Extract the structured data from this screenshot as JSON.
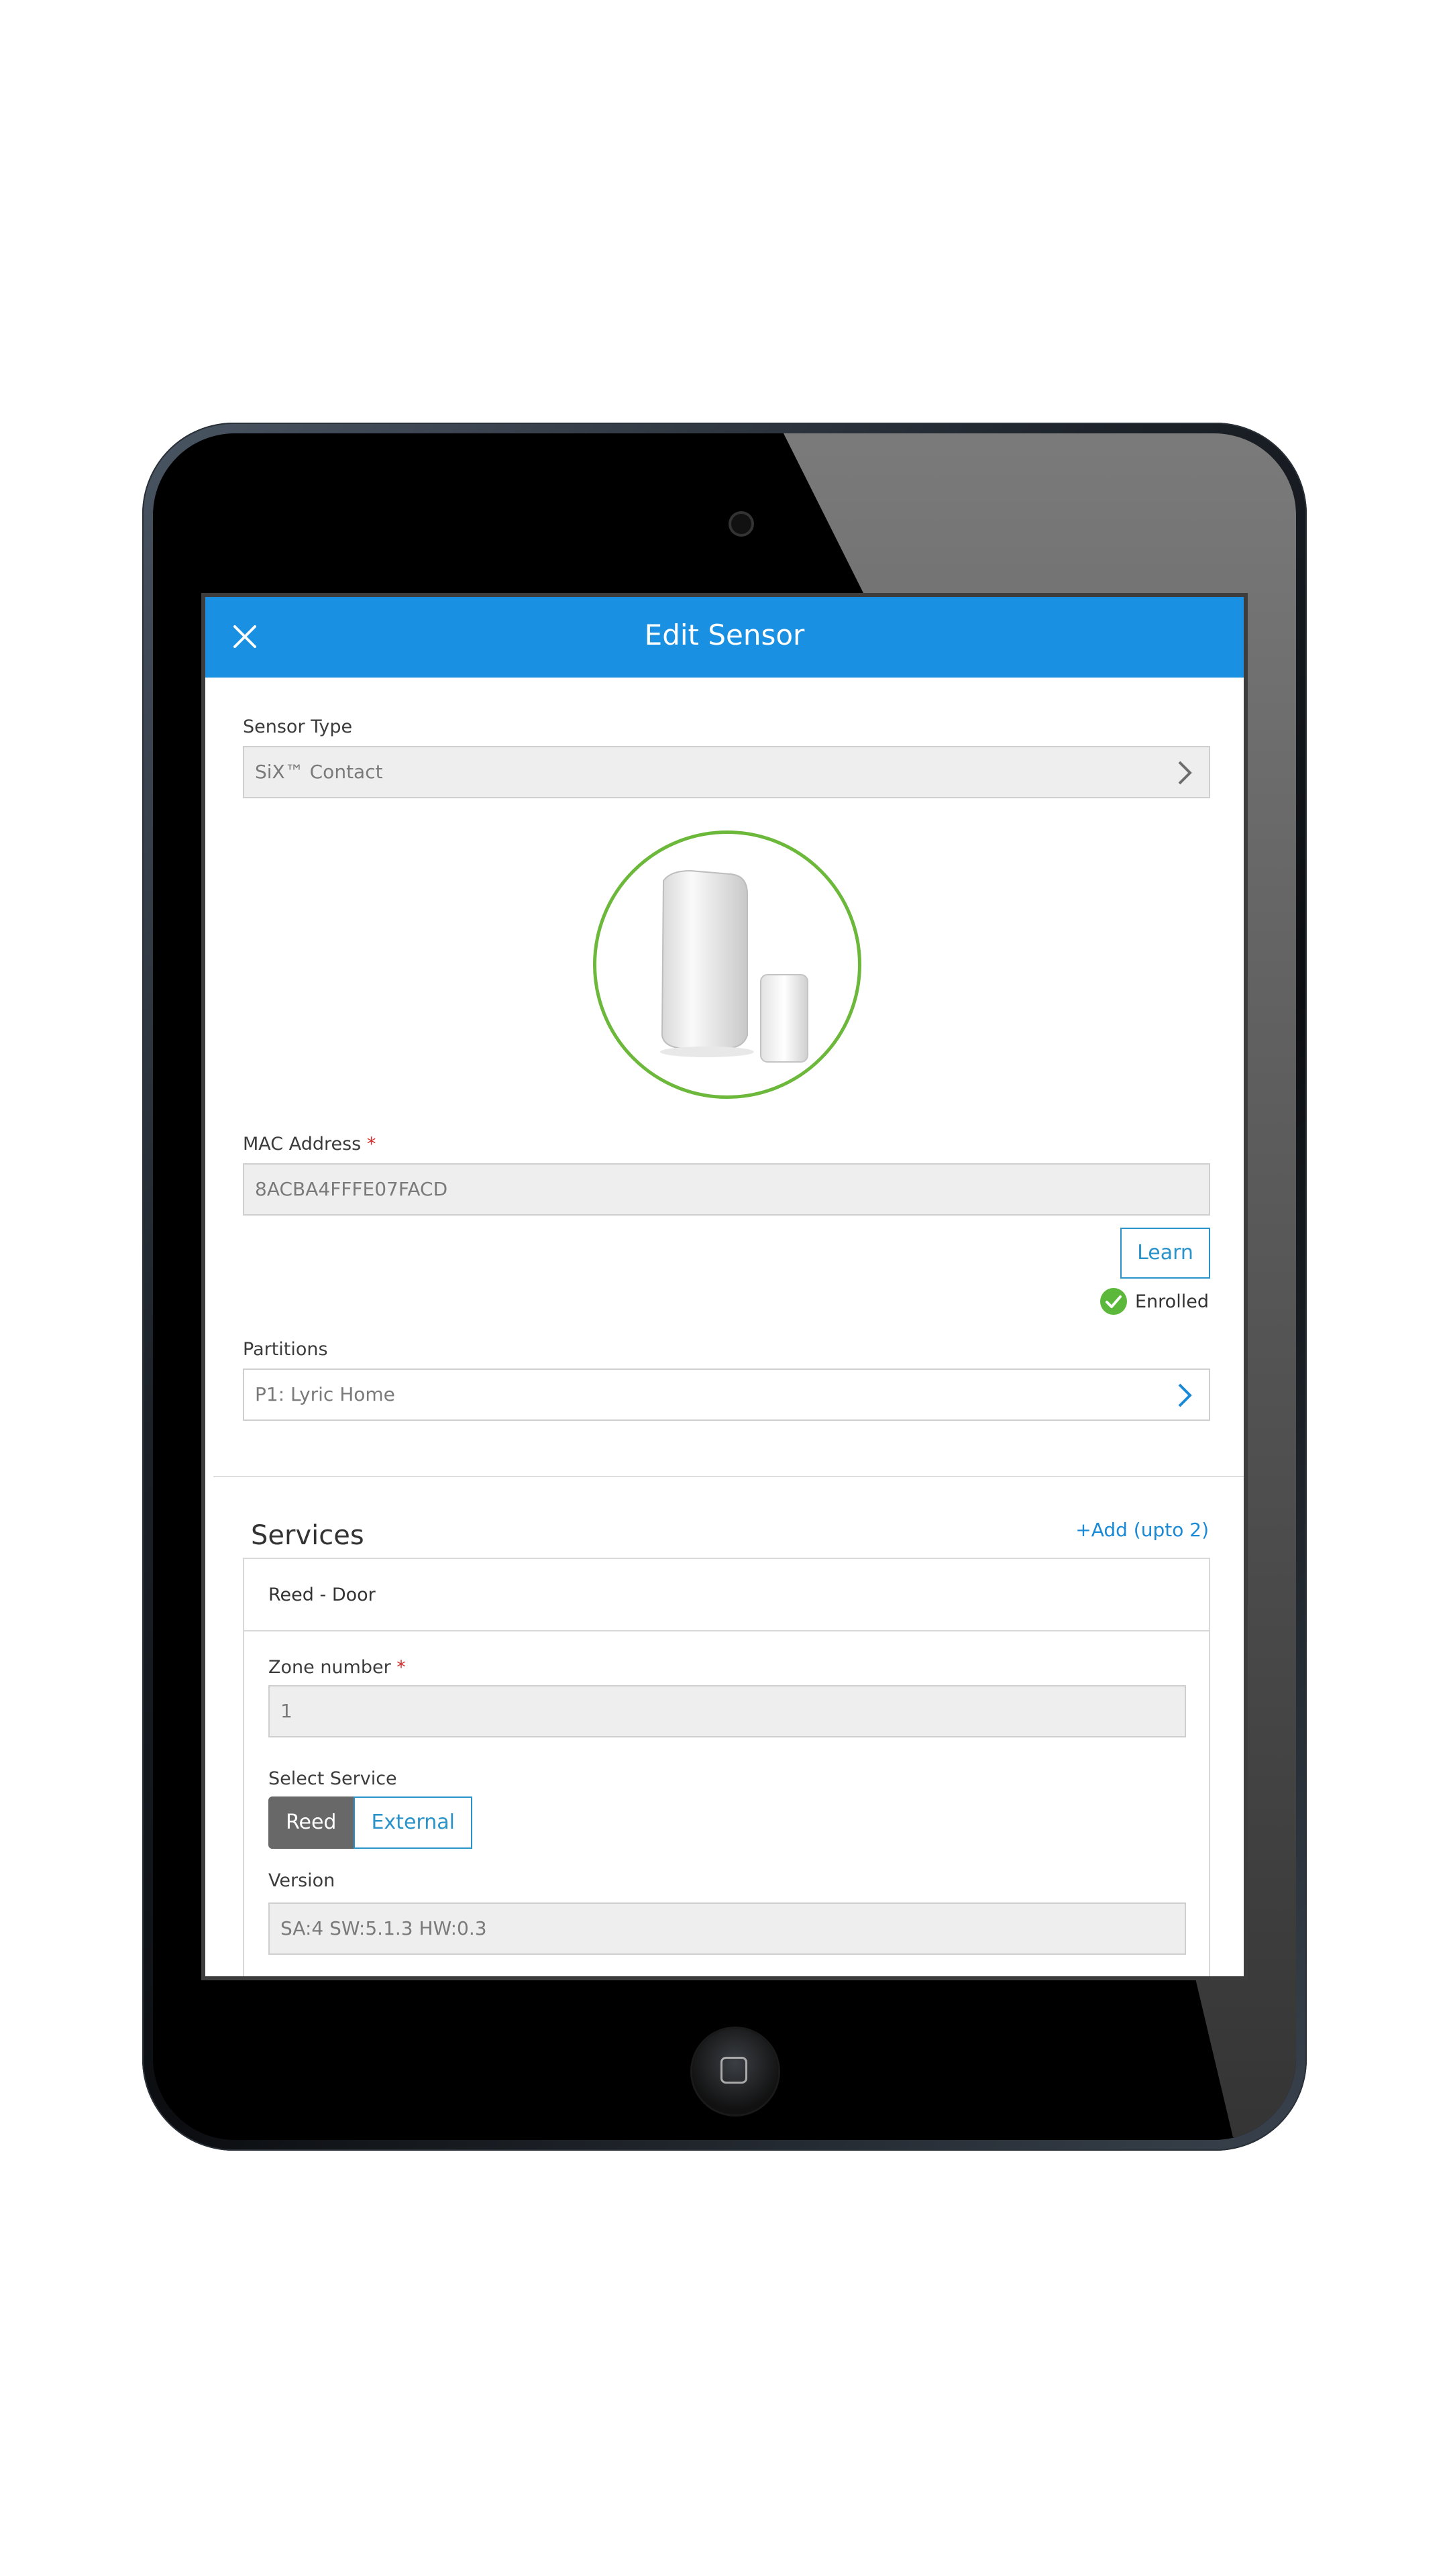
{
  "header": {
    "title": "Edit Sensor"
  },
  "sensor_type": {
    "label": "Sensor Type",
    "value": "SiX™ Contact"
  },
  "mac_address": {
    "label": "MAC Address",
    "required_mark": "*",
    "value": "8ACBA4FFFE07FACD"
  },
  "learn_button": {
    "label": "Learn"
  },
  "enrollment": {
    "status": "Enrolled"
  },
  "partitions": {
    "label": "Partitions",
    "value": "P1: Lyric Home"
  },
  "services": {
    "title": "Services",
    "add_link": "+Add (upto 2)",
    "items": [
      {
        "name": "Reed - Door",
        "zone_label": "Zone number",
        "zone_required_mark": "*",
        "zone_value": "1",
        "select_service_label": "Select Service",
        "options": [
          "Reed",
          "External"
        ],
        "selected": "Reed",
        "version_label": "Version",
        "version_value": "SA:4 SW:5.1.3 HW:0.3"
      }
    ]
  },
  "colors": {
    "app_bar": "#1a90e3",
    "accent": "#2a93c9",
    "enrolled_green": "#5cb83a",
    "required_red": "#d32f2f"
  }
}
